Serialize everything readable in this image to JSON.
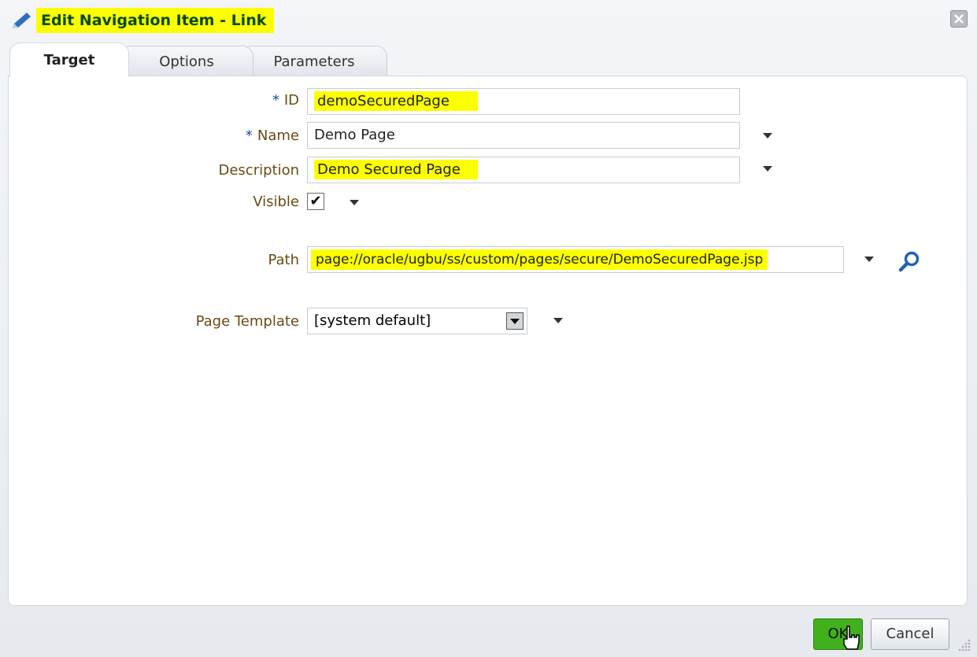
{
  "dialog": {
    "title": "Edit Navigation Item - Link",
    "close_icon": "close-icon"
  },
  "tabs": [
    {
      "label": "Target",
      "active": true
    },
    {
      "label": "Options",
      "active": false
    },
    {
      "label": "Parameters",
      "active": false
    }
  ],
  "form": {
    "id": {
      "required_mark": "*",
      "label": "ID",
      "value": "demoSecuredPage"
    },
    "name": {
      "required_mark": "*",
      "label": "Name",
      "value": "Demo Page"
    },
    "description": {
      "label": "Description",
      "value": "Demo Secured Page"
    },
    "visible": {
      "label": "Visible",
      "checked": true,
      "check_mark": "✔"
    },
    "path": {
      "label": "Path",
      "value": "page://oracle/ugbu/ss/custom/pages/secure/DemoSecuredPage.jsp"
    },
    "page_template": {
      "label": "Page Template",
      "value": "[system default]"
    }
  },
  "footer": {
    "ok_label": "OK",
    "cancel_label": "Cancel"
  },
  "colors": {
    "highlight": "#fcff00",
    "label": "#6b4a12",
    "required": "#1a4ea1",
    "ok_button": "#40b01c"
  }
}
